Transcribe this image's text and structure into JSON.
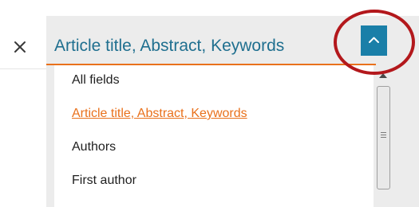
{
  "search_field": {
    "selected_label": "Article title, Abstract, Keywords",
    "options": [
      {
        "label": "All fields",
        "selected": false
      },
      {
        "label": "Article title, Abstract, Keywords",
        "selected": true
      },
      {
        "label": "Authors",
        "selected": false
      },
      {
        "label": "First author",
        "selected": false
      }
    ],
    "toggle_state": "expanded"
  },
  "icons": {
    "close": "close-icon",
    "toggle": "chevron-up-icon",
    "scroll_up": "scroll-up-arrow-icon",
    "scroll_grip": "scroll-grip-icon"
  },
  "colors": {
    "label_text": "#1f6f8f",
    "accent_orange": "#e9711c",
    "toggle_bg": "#1a7fa8",
    "annotation_ring": "#b3181c",
    "panel_bg": "#ececec"
  }
}
